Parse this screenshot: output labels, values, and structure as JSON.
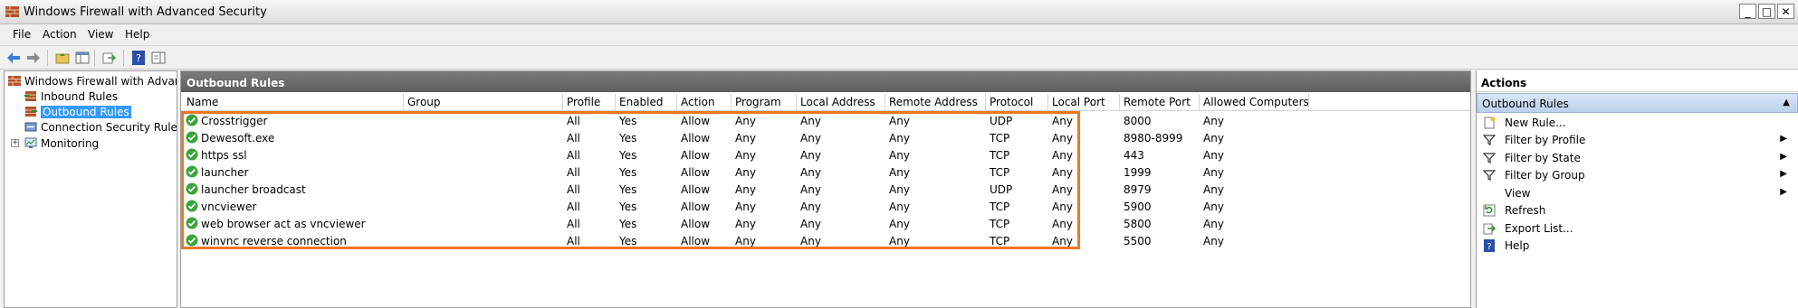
{
  "window": {
    "title": "Windows Firewall with Advanced Security"
  },
  "menu": [
    "File",
    "Action",
    "View",
    "Help"
  ],
  "toolbar": [
    "back-icon",
    "forward-icon",
    "up-folder-icon",
    "show-hide-tree-icon",
    "export-icon",
    "help-icon",
    "show-action-pane-icon"
  ],
  "tree": {
    "root": "Windows Firewall with Advance",
    "items": [
      {
        "label": "Inbound Rules",
        "icon": "inbound-rules-icon"
      },
      {
        "label": "Outbound Rules",
        "icon": "outbound-rules-icon",
        "selected": true
      },
      {
        "label": "Connection Security Rules",
        "icon": "connection-security-icon"
      },
      {
        "label": "Monitoring",
        "icon": "monitoring-icon"
      }
    ]
  },
  "main": {
    "title": "Outbound Rules",
    "columns": [
      "Name",
      "Group",
      "Profile",
      "Enabled",
      "Action",
      "Program",
      "Local Address",
      "Remote Address",
      "Protocol",
      "Local Port",
      "Remote Port",
      "Allowed Computers"
    ],
    "rows": [
      [
        "Crosstrigger",
        "",
        "All",
        "Yes",
        "Allow",
        "Any",
        "Any",
        "Any",
        "UDP",
        "Any",
        "8000",
        "Any"
      ],
      [
        "Dewesoft.exe",
        "",
        "All",
        "Yes",
        "Allow",
        "Any",
        "Any",
        "Any",
        "TCP",
        "Any",
        "8980-8999",
        "Any"
      ],
      [
        "https ssl",
        "",
        "All",
        "Yes",
        "Allow",
        "Any",
        "Any",
        "Any",
        "TCP",
        "Any",
        "443",
        "Any"
      ],
      [
        "launcher",
        "",
        "All",
        "Yes",
        "Allow",
        "Any",
        "Any",
        "Any",
        "TCP",
        "Any",
        "1999",
        "Any"
      ],
      [
        "launcher broadcast",
        "",
        "All",
        "Yes",
        "Allow",
        "Any",
        "Any",
        "Any",
        "UDP",
        "Any",
        "8979",
        "Any"
      ],
      [
        "vncviewer",
        "",
        "All",
        "Yes",
        "Allow",
        "Any",
        "Any",
        "Any",
        "TCP",
        "Any",
        "5900",
        "Any"
      ],
      [
        "web browser act as vncviewer",
        "",
        "All",
        "Yes",
        "Allow",
        "Any",
        "Any",
        "Any",
        "TCP",
        "Any",
        "5800",
        "Any"
      ],
      [
        "winvnc reverse connection",
        "",
        "All",
        "Yes",
        "Allow",
        "Any",
        "Any",
        "Any",
        "TCP",
        "Any",
        "5500",
        "Any"
      ]
    ]
  },
  "actions": {
    "title": "Actions",
    "section": "Outbound Rules",
    "items": [
      {
        "label": "New Rule...",
        "icon": "new-rule-icon",
        "submenu": false
      },
      {
        "label": "Filter by Profile",
        "icon": "filter-icon",
        "submenu": true
      },
      {
        "label": "Filter by State",
        "icon": "filter-icon",
        "submenu": true
      },
      {
        "label": "Filter by Group",
        "icon": "filter-icon",
        "submenu": true
      },
      {
        "label": "View",
        "icon": "",
        "submenu": true
      },
      {
        "label": "Refresh",
        "icon": "refresh-icon",
        "submenu": false
      },
      {
        "label": "Export List...",
        "icon": "export-list-icon",
        "submenu": false
      },
      {
        "label": "Help",
        "icon": "help-icon",
        "submenu": false
      }
    ]
  },
  "colors": {
    "highlight": "#f07621",
    "selection": "#3399ff",
    "ok_green": "#3aa43a"
  }
}
